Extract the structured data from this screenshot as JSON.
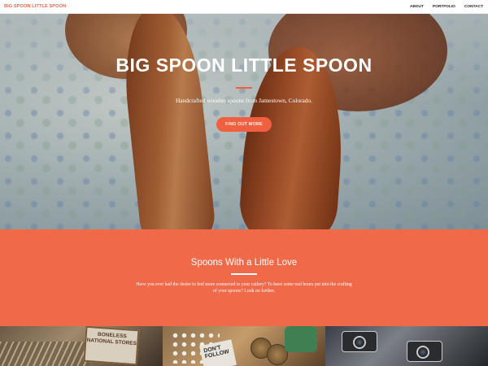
{
  "navbar": {
    "brand": "BIG SPOON LITTLE SPOON",
    "links": [
      "ABOUT",
      "PORTFOLIO",
      "CONTACT"
    ]
  },
  "hero": {
    "title": "BIG SPOON LITTLE SPOON",
    "subtitle": "Handcrafted wooden spoons from Jamestown, Colorado.",
    "button_label": "FIND OUT MORE"
  },
  "about": {
    "title": "Spoons With a Little Love",
    "text": "Have you ever had the desire to feel more connected to your cutlery? To have some real hours put into the crafting of your spoons? Look no further."
  },
  "portfolio": {
    "items": [
      {
        "sign_text": "BONELESS\nNATIONAL STORES"
      },
      {
        "card_text": "DON'T\nFOLLOW"
      },
      {}
    ]
  },
  "colors": {
    "accent": "#f05f40",
    "section_bg": "#f06a4a",
    "nav_bg": "#ffffff"
  }
}
